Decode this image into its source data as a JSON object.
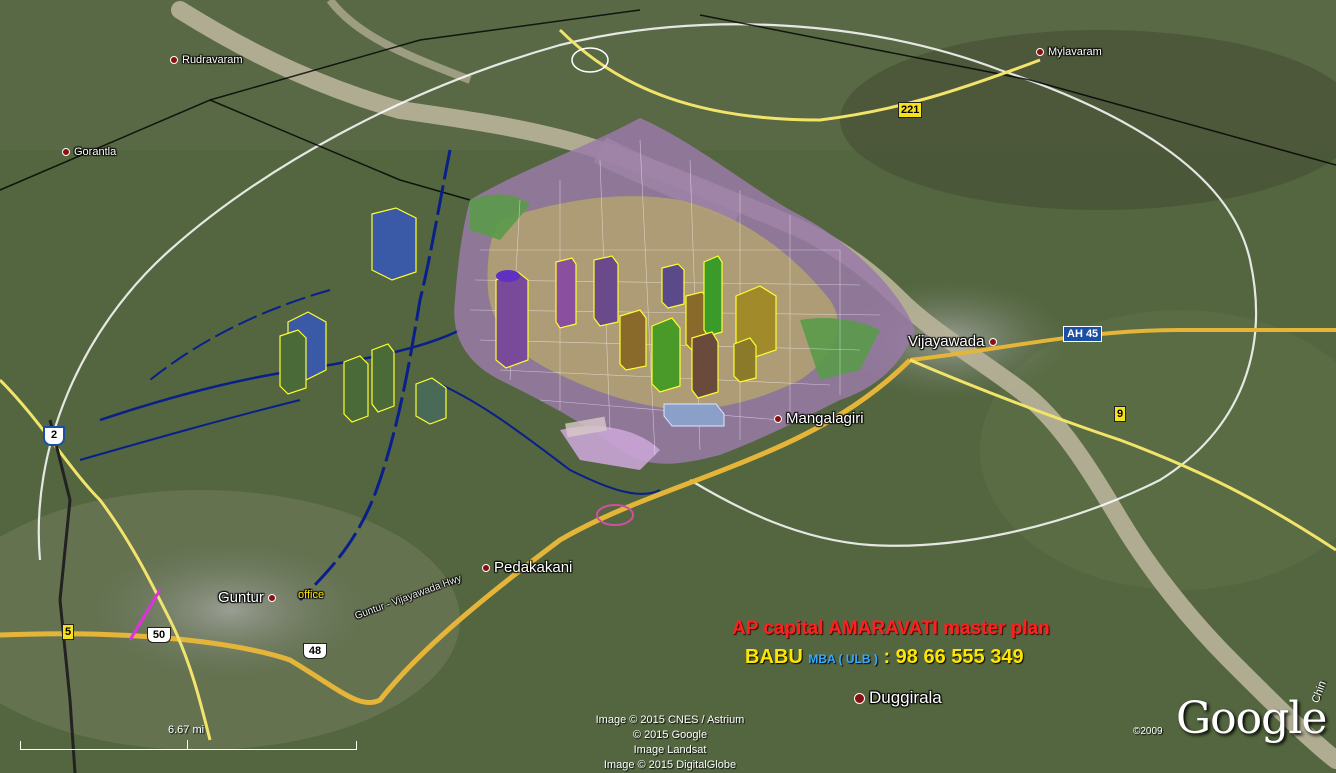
{
  "places": {
    "rudravaram": "Rudravaram",
    "gorantla": "Gorantla",
    "mylavaram": "Mylavaram",
    "vijayawada": "Vijayawada",
    "mangalagiri": "Mangalagiri",
    "pedakakani": "Pedakakani",
    "guntur": "Guntur",
    "office": "office",
    "duggirala": "Duggirala",
    "edge_label": "Chin"
  },
  "shields": {
    "nh221": "221",
    "ah45": "AH 45",
    "nh9": "9",
    "nh5": "5",
    "us50": "50",
    "us48": "48",
    "int2": "2"
  },
  "promo": {
    "title": "AP capital AMARAVATI master plan",
    "name": "BABU",
    "qualification": "MBA ( ULB )",
    "phone": ": 98 66 555 349"
  },
  "credits": {
    "line1": "Image © 2015 CNES / Astrium",
    "line2": "© 2015 Google",
    "line3": "Image Landsat",
    "line4": "Image © 2015 DigitalGlobe"
  },
  "scale_label": "6.67 mi",
  "google_logo": "Google",
  "copyright_year": "©2009",
  "road_label": "Guntur - Vijayawada Hwy",
  "colors": {
    "river": "#b9b49a",
    "road_major": "#e5b53a",
    "road_minor": "#f2e36a",
    "boundary": "#ffffff",
    "pipeline": "#0a1f8a",
    "promo_red": "#ff2020",
    "promo_yellow": "#ffe600"
  }
}
